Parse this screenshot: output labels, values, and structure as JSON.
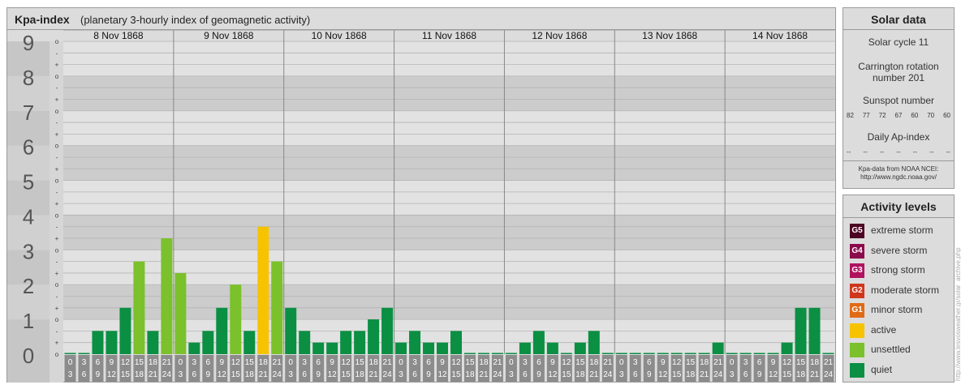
{
  "header": {
    "title": "Kpa-index",
    "subtitle": "(planetary 3-hourly index of geomagnetic activity)"
  },
  "chart_data": {
    "type": "bar",
    "title": "Kpa-index",
    "subtitle": "(planetary 3-hourly index of geomagnetic activity)",
    "ylim": [
      0,
      9
    ],
    "y_ticks": [
      "0",
      "1",
      "2",
      "3",
      "4",
      "5",
      "6",
      "7",
      "8",
      "9"
    ],
    "minor_tick_labels": [
      "o",
      "+",
      "-"
    ],
    "grid": true,
    "days": [
      "8 Nov 1868",
      "9 Nov 1868",
      "10 Nov 1868",
      "11 Nov 1868",
      "12 Nov 1868",
      "13 Nov 1868",
      "14 Nov 1868"
    ],
    "interval_start_labels": [
      "0",
      "3",
      "6",
      "9",
      "12",
      "15",
      "18",
      "21"
    ],
    "interval_end_labels": [
      "3",
      "6",
      "9",
      "12",
      "15",
      "18",
      "21",
      "24"
    ],
    "series": [
      {
        "values": [
          0,
          0,
          0.667,
          0.667,
          1.333,
          2.667,
          0.667,
          3.333,
          2.333,
          0.333,
          0.667,
          1.333,
          2,
          0.667,
          3.667,
          2.667,
          1.333,
          0.667,
          0.333,
          0.333,
          0.667,
          0.667,
          1,
          1.333,
          0.333,
          0.667,
          0.333,
          0.333,
          0.667,
          0,
          0,
          0,
          0,
          0.333,
          0.667,
          0.333,
          0,
          0.333,
          0.667,
          0,
          0,
          0,
          0,
          0,
          0,
          0,
          0,
          0.333,
          0,
          0,
          0,
          0,
          0.333,
          1.333,
          1.333,
          0
        ]
      }
    ],
    "level_colors": {
      "quiet": "#0a8f43",
      "unsettled": "#7bc12b",
      "active": "#f7c300",
      "G1": "#e06b17",
      "G2": "#d0361c",
      "G3": "#b0125f",
      "G4": "#8b0a4c",
      "G5": "#4b0422"
    }
  },
  "solar": {
    "title": "Solar data",
    "cycle": "Solar cycle 11",
    "carrington_line1": "Carrington rotation",
    "carrington_line2": "number 201",
    "sunspot_title": "Sunspot number",
    "sunspots": [
      "82",
      "77",
      "72",
      "67",
      "60",
      "70",
      "60"
    ],
    "ap_title": "Daily Ap-index",
    "ap_values": [
      "--",
      "--",
      "--",
      "--",
      "--",
      "--",
      "--"
    ],
    "source_line1": "Kpa-data from NOAA NCEI:",
    "source_line2": "http://www.ngdc.noaa.gov/"
  },
  "levels": {
    "title": "Activity levels",
    "items": [
      {
        "badge": "G5",
        "label": "extreme storm",
        "color": "#4b0422"
      },
      {
        "badge": "G4",
        "label": "severe storm",
        "color": "#8b0a4c"
      },
      {
        "badge": "G3",
        "label": "strong storm",
        "color": "#b0125f"
      },
      {
        "badge": "G2",
        "label": "moderate storm",
        "color": "#d0361c"
      },
      {
        "badge": "G1",
        "label": "minor storm",
        "color": "#e06b17"
      },
      {
        "badge": "",
        "label": "active",
        "color": "#f7c300"
      },
      {
        "badge": "",
        "label": "unsettled",
        "color": "#7bc12b"
      },
      {
        "badge": "",
        "label": "quiet",
        "color": "#0a8f43"
      }
    ]
  },
  "credit": "http://www.lesvosweather.gr/solar_archive.php"
}
